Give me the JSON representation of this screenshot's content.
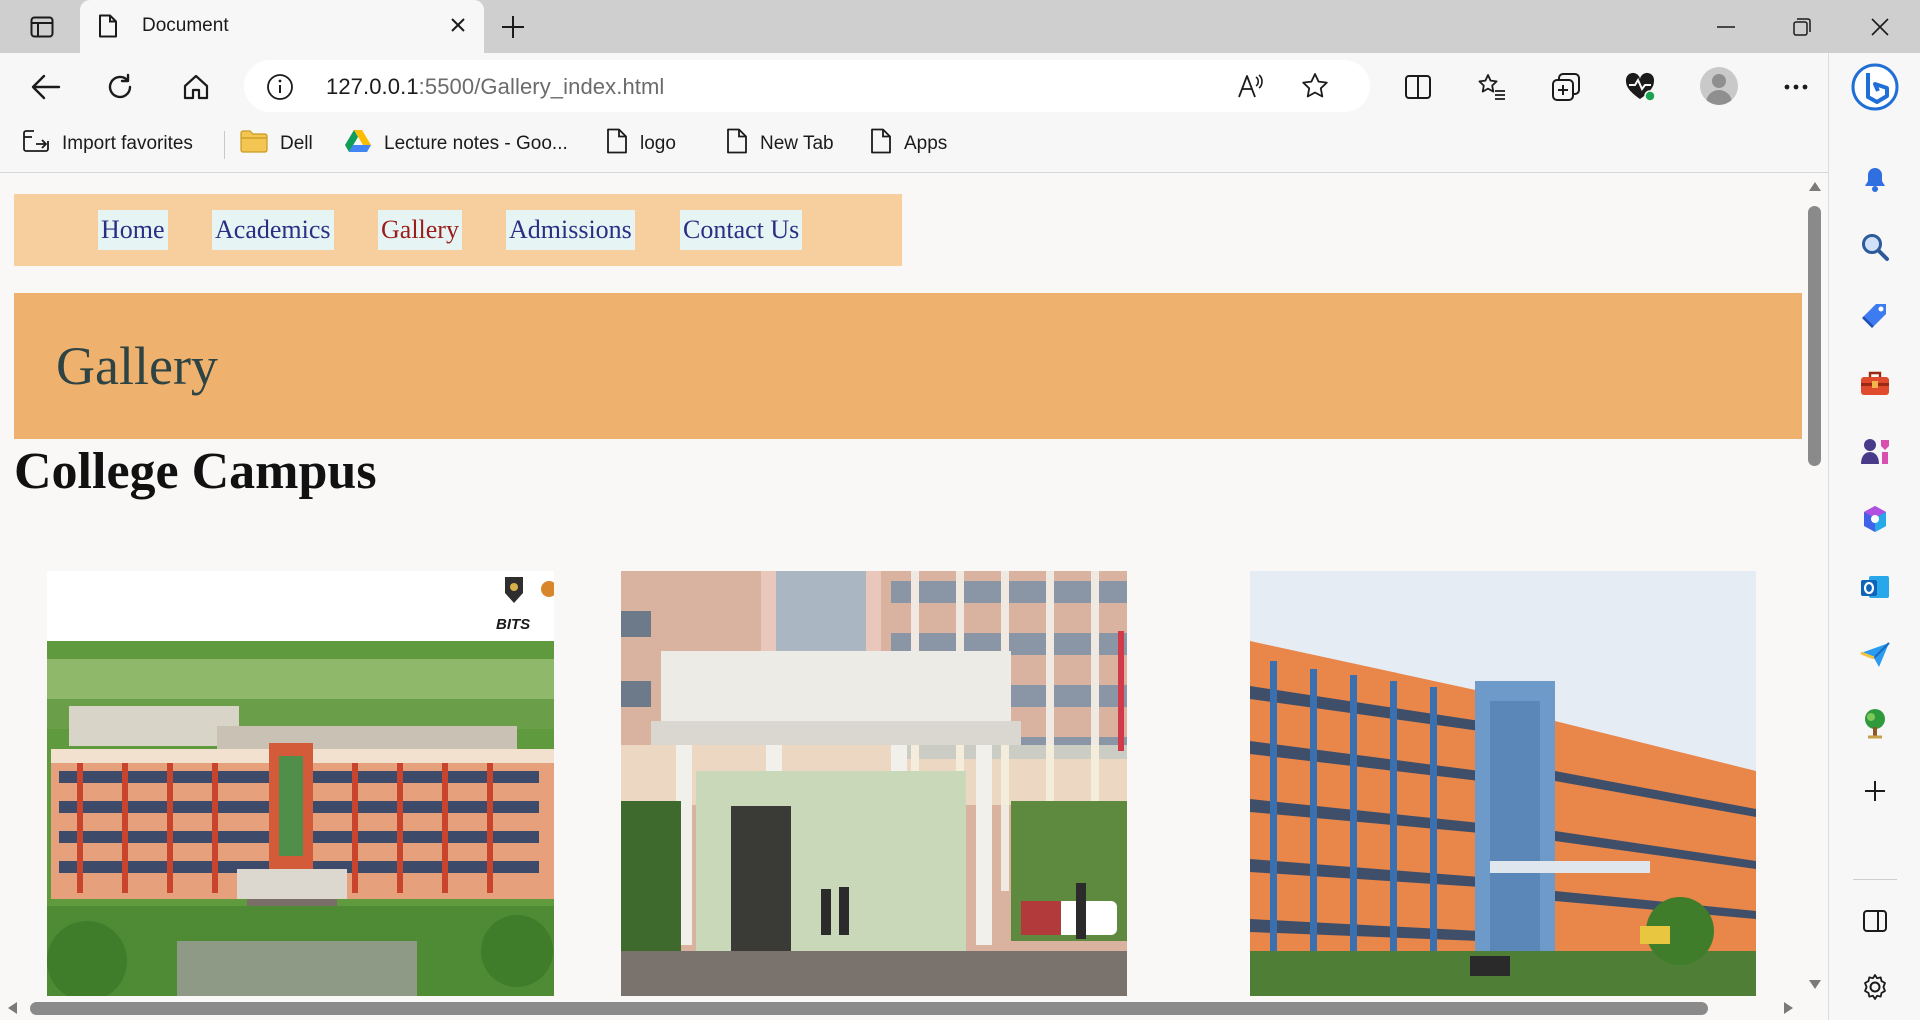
{
  "browser": {
    "tab_title": "Document",
    "url_host": "127.0.0.1",
    "url_rest": ":5500/Gallery_index.html",
    "bookmarks": [
      {
        "label": "Import favorites",
        "icon": "import-icon"
      },
      {
        "label": "Dell",
        "icon": "folder-icon"
      },
      {
        "label": "Lecture notes - Goo...",
        "icon": "google-drive-icon"
      },
      {
        "label": "logo",
        "icon": "page-icon"
      },
      {
        "label": "New Tab",
        "icon": "page-icon"
      },
      {
        "label": "Apps",
        "icon": "page-icon"
      }
    ],
    "sidebar_icons": [
      "bing-icon",
      "bell-icon",
      "search-icon",
      "tag-icon",
      "toolbox-icon",
      "games-icon",
      "office-icon",
      "outlook-icon",
      "send-icon",
      "tree-icon",
      "add-icon",
      "sidebar-toggle-icon",
      "settings-icon"
    ]
  },
  "site": {
    "nav": [
      "Home",
      "Academics",
      "Gallery",
      "Admissions",
      "Contact Us"
    ],
    "active_nav": "Gallery",
    "banner_title": "Gallery",
    "section_title": "College Campus",
    "photo_badge": "BITS"
  },
  "colors": {
    "nav_bg": "#f7cf9f",
    "nav_link_bg": "#e6f5f3",
    "nav_link": "#2a2f86",
    "nav_active": "#9b1d1d",
    "banner_bg": "#efb26e",
    "banner_text": "#2e4444"
  }
}
